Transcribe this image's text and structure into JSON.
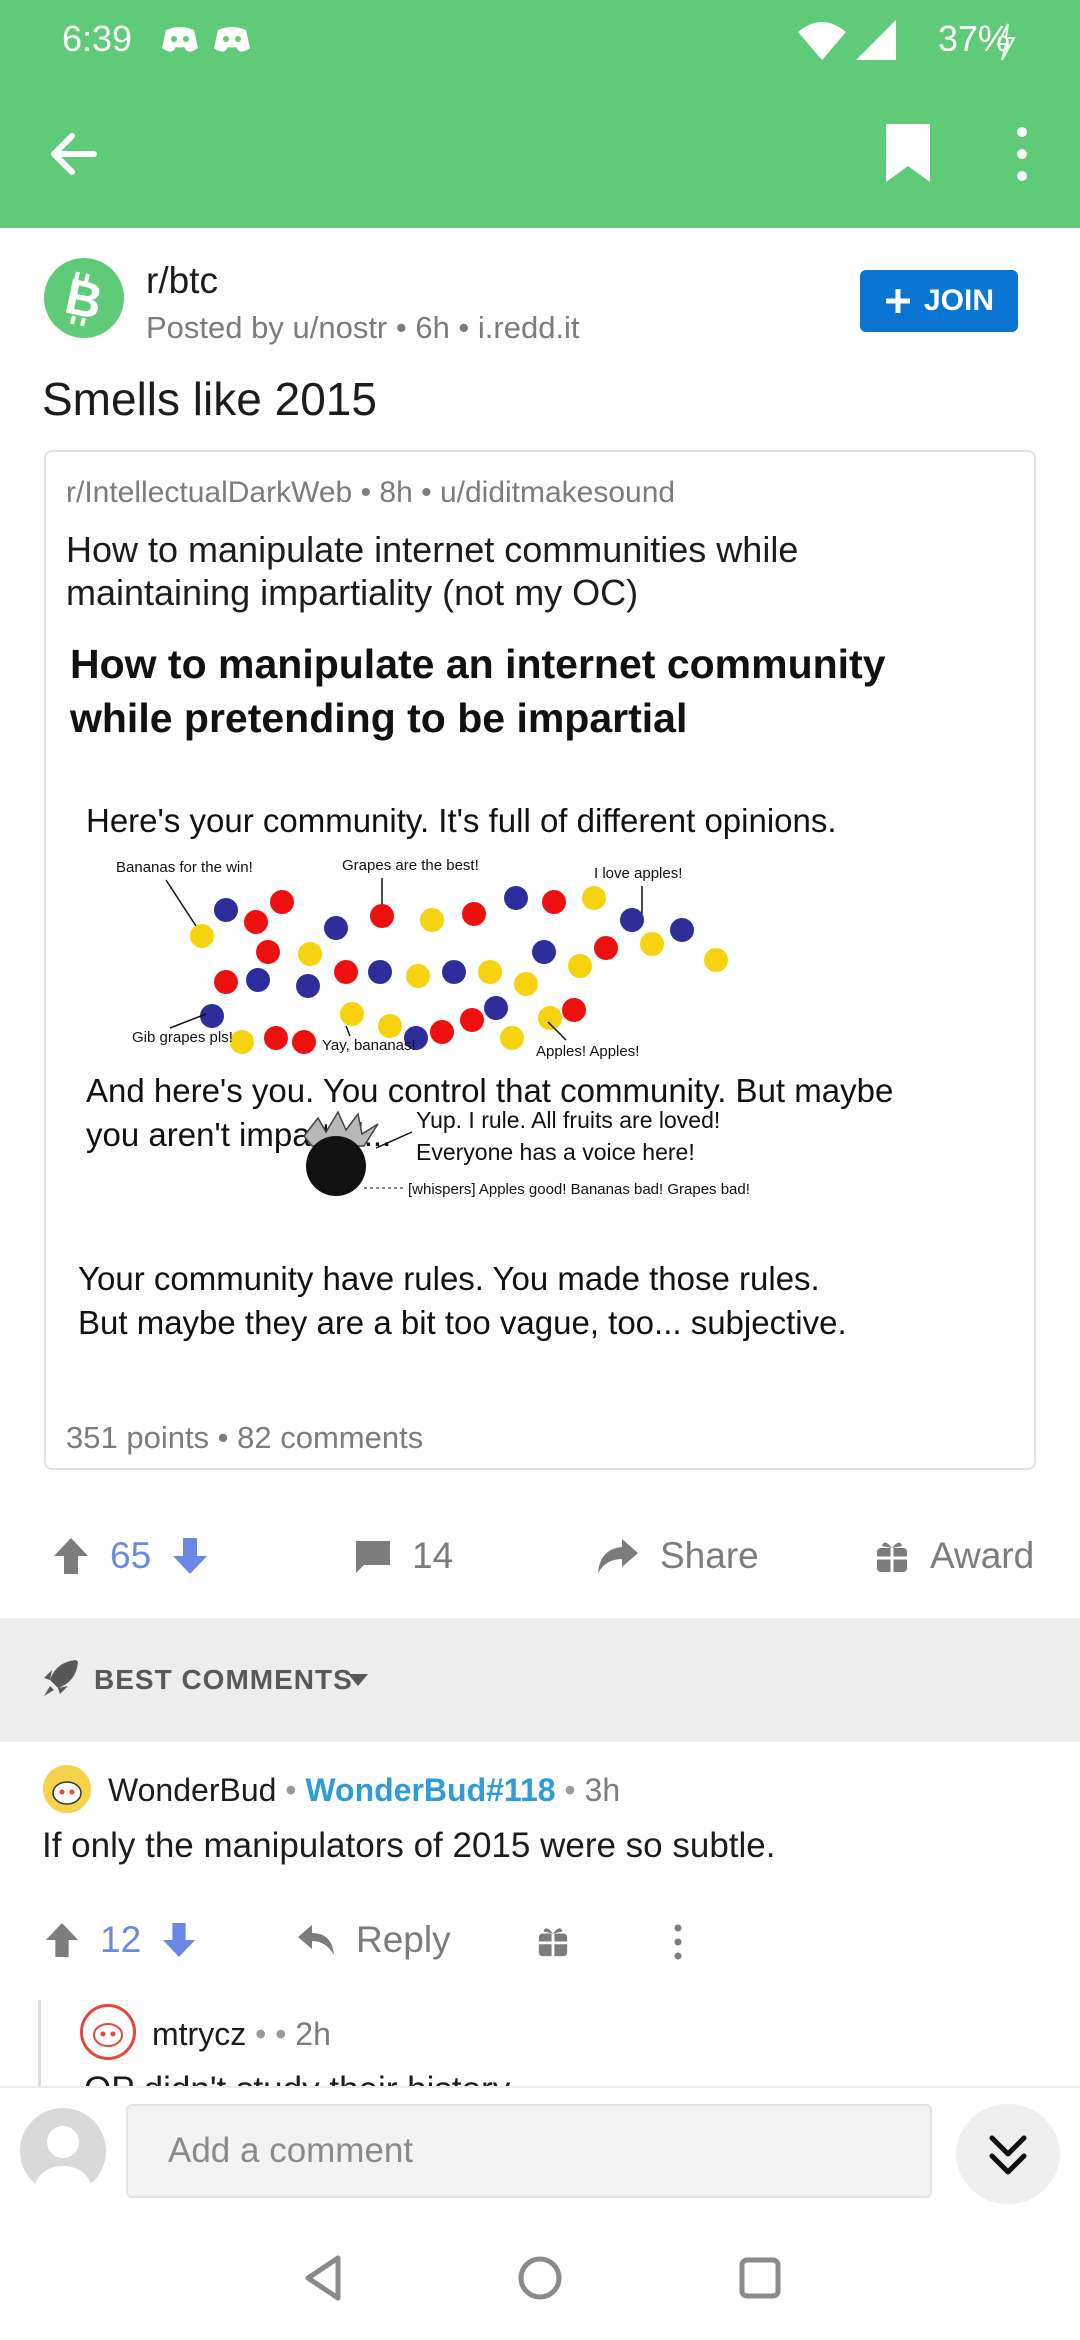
{
  "status_bar": {
    "time": "6:39",
    "battery": "37%"
  },
  "post": {
    "subreddit": "r/btc",
    "meta": "Posted by u/nostr • 6h • i.redd.it",
    "join_label": "JOIN",
    "title": "Smells like 2015",
    "crosspost": {
      "meta": "r/IntellectualDarkWeb • 8h • u/diditmakesound",
      "title": "How to manipulate internet communities while maintaining impartiality (not my OC)",
      "image_text": {
        "heading_line1": "How to manipulate an internet community",
        "heading_line2": "while pretending to be impartial",
        "intro": "Here's your community. It's full of different opinions.",
        "label_bananas": "Bananas for the win!",
        "label_grapes": "Grapes are the best!",
        "label_apples": "I love apples!",
        "label_gib": "Gib grapes pls!",
        "label_yay": "Yay, bananas!",
        "label_apples2": "Apples! Apples!",
        "you_line1": "And here's you. You control that community. But maybe",
        "you_line2": "you aren't impartial...",
        "speech1": "Yup. I rule. All fruits are loved!",
        "speech2": "Everyone has a voice here!",
        "whisper": "[whispers] Apples good! Bananas bad! Grapes bad!",
        "rules_line1": "Your community have rules. You made those rules.",
        "rules_line2": "But maybe they are a bit too vague, too... subjective."
      },
      "footer": "351 points • 82 comments"
    },
    "votes": "65",
    "comments_count": "14",
    "share_label": "Share",
    "award_label": "Award"
  },
  "sort": {
    "label": "BEST COMMENTS"
  },
  "comment": {
    "author": "WonderBud",
    "flair": "WonderBud#118",
    "time": "3h",
    "body": "If only the manipulators of 2015 were so subtle.",
    "votes": "12",
    "reply_label": "Reply"
  },
  "reply": {
    "author": "mtrycz",
    "time": "2h",
    "body": "OP didn't study their history"
  },
  "composer": {
    "placeholder": "Add a comment"
  },
  "colors": {
    "header_green": "#5fcb79",
    "join_blue": "#0a76d2",
    "vote_blue": "#6a88e6",
    "flair_blue": "#2f9bd8"
  }
}
